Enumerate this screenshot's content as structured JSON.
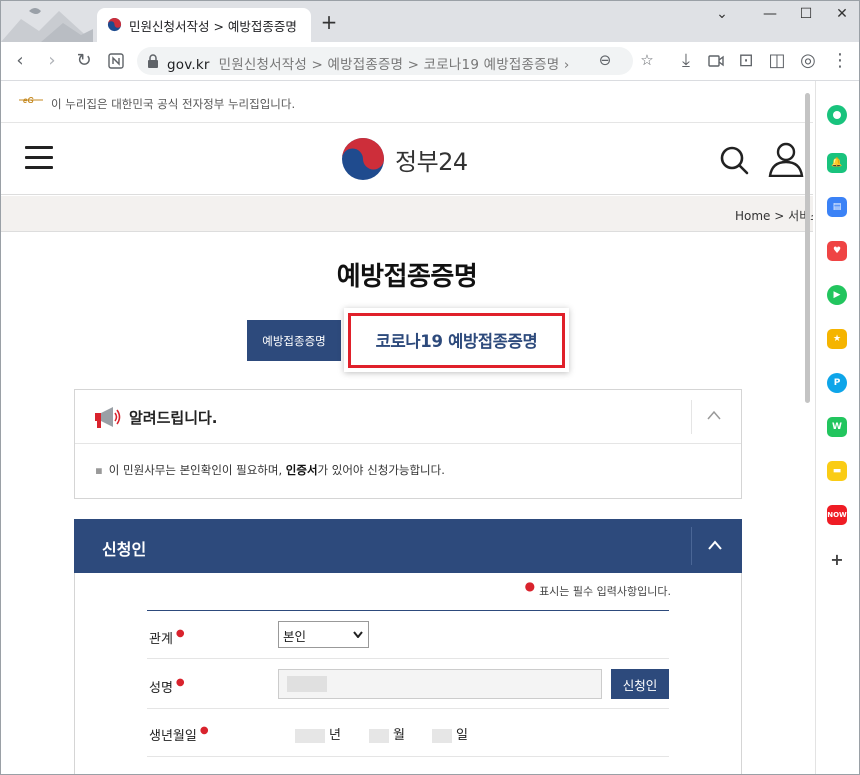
{
  "browser": {
    "tab_title": "민원신청서작성 > 예방접종증명",
    "url_host": "gov.kr",
    "url_path": "민원신청서작성 > 예방접종증명 > 코로나19 예방접종증명 ›"
  },
  "page": {
    "gov_notice": "이 누리집은 대한민국 공식 전자정부 누리집입니다.",
    "brand_name": "정부24",
    "breadcrumb": "Home  >  서비스",
    "title": "예방접종증명",
    "tab_general": "예방접종증명",
    "tab_covid": "코로나19 예방접종증명",
    "notice_title": "알려드립니다.",
    "notice_text_before": "이 민원사무는 본인확인이 필요하며, ",
    "notice_text_bold": "인증서",
    "notice_text_after": "가 있어야 신청가능합니다.",
    "applicant_title": "신청인",
    "required_note": "표시는 필수 입력사항입니다.",
    "form": {
      "relation_label": "관계",
      "relation_value": "본인",
      "name_label": "성명",
      "applicant_button": "신청인",
      "birth_label": "생년월일",
      "year_unit": "년",
      "month_unit": "월",
      "day_unit": "일"
    }
  },
  "colors": {
    "primary_navy": "#2d4a7c",
    "highlight_red": "#e0202a",
    "required_red": "#d9232d"
  }
}
